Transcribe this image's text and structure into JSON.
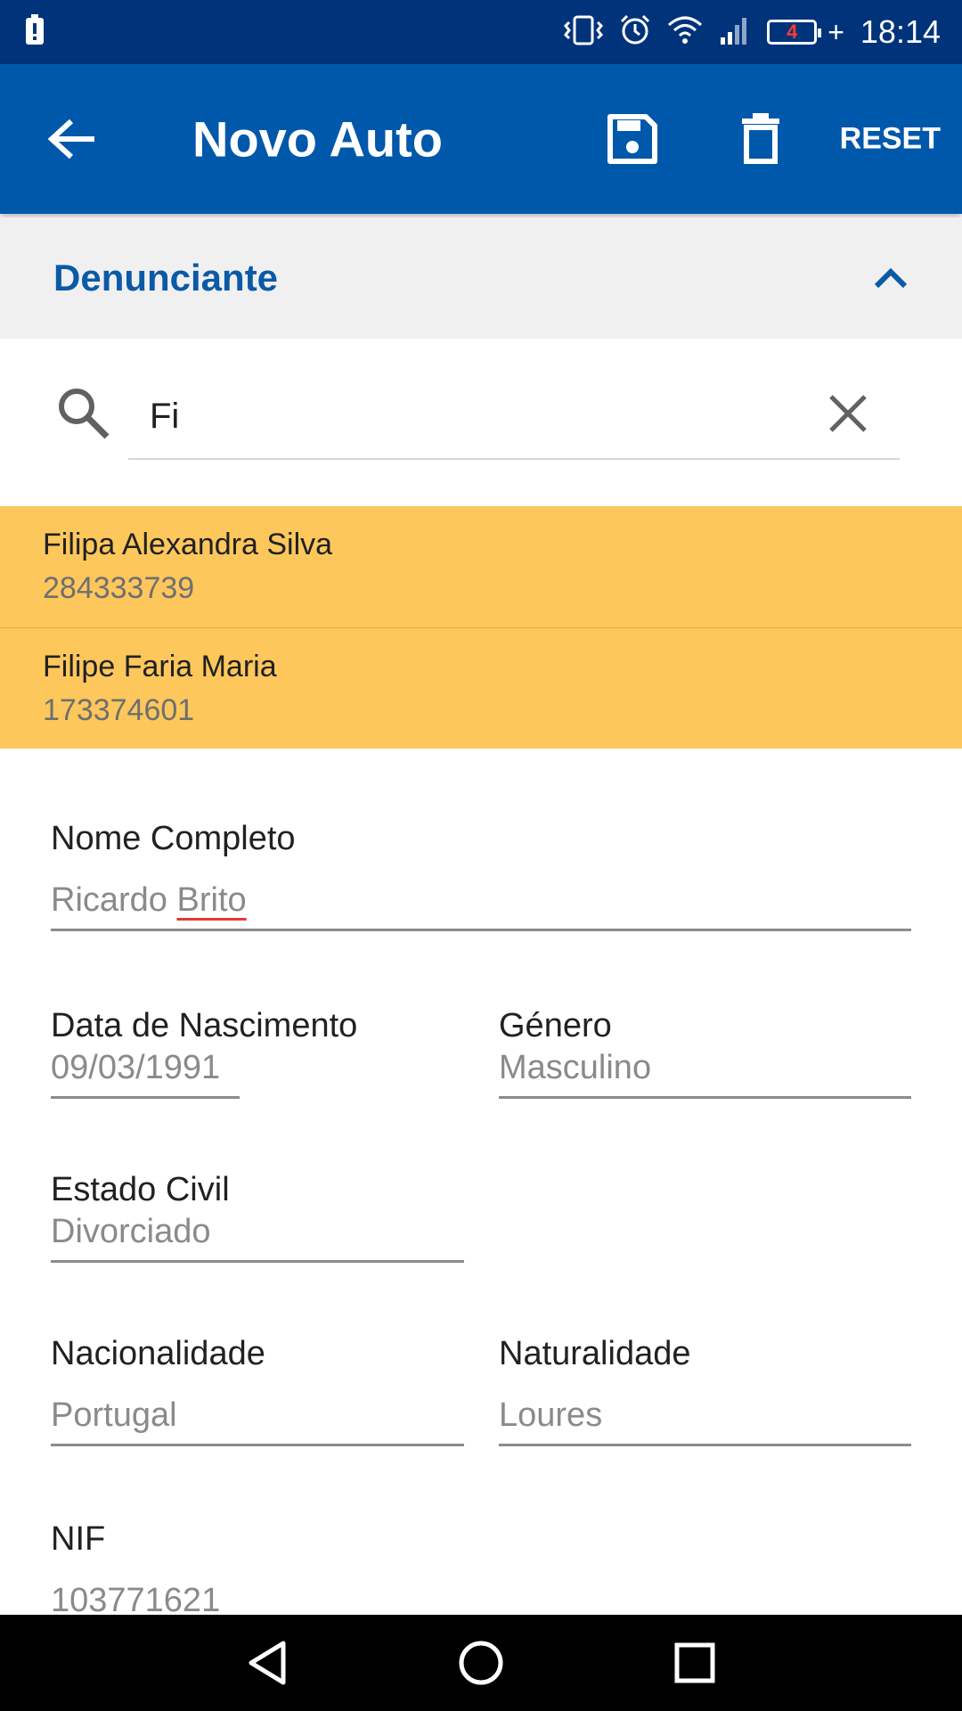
{
  "status_bar": {
    "time": "18:14",
    "battery_level": "4",
    "icons": [
      "alert-icon",
      "vibrate-icon",
      "alarm-icon",
      "wifi-icon",
      "signal-icon",
      "battery-icon"
    ]
  },
  "app_bar": {
    "title": "Novo Auto",
    "reset_label": "RESET",
    "icons": [
      "back-arrow-icon",
      "save-icon",
      "delete-icon"
    ],
    "color": "#0058ab"
  },
  "section": {
    "title": "Denunciante",
    "icon": "chevron-up-icon"
  },
  "search": {
    "value": "Fi",
    "placeholder": ""
  },
  "suggestions": [
    {
      "name": "Filipa Alexandra Silva",
      "id": "284333739"
    },
    {
      "name": "Filipe Faria Maria",
      "id": "173374601"
    }
  ],
  "form": {
    "nome_completo": {
      "label": "Nome Completo",
      "value_first": "Ricardo",
      "value_last": "Brito"
    },
    "data_nascimento": {
      "label": "Data de Nascimento",
      "value": "09/03/1991"
    },
    "genero": {
      "label": "Género",
      "value": "Masculino"
    },
    "estado_civil": {
      "label": "Estado Civil",
      "value": "Divorciado"
    },
    "nacionalidade": {
      "label": "Nacionalidade",
      "value": "Portugal"
    },
    "naturalidade": {
      "label": "Naturalidade",
      "value": "Loures"
    },
    "nif": {
      "label": "NIF",
      "value": "103771621"
    }
  },
  "nav_bar": {
    "icons": [
      "back-triangle-icon",
      "home-circle-icon",
      "recents-square-icon"
    ]
  },
  "colors": {
    "status_bar": "#00337a",
    "suggestion_bg": "#fdc75c",
    "section_title": "#0a5aa8",
    "spellcheck_underline": "#e53935"
  }
}
